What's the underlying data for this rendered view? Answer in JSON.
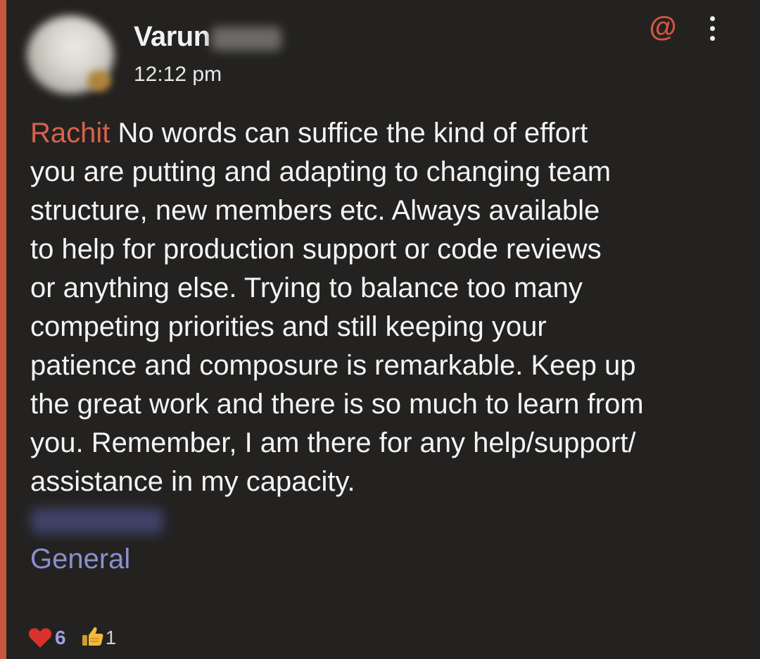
{
  "message": {
    "sender_name": "Varun",
    "timestamp": "12:12 pm",
    "mention_name": "Rachit",
    "body_lines": [
      " No words can suffice the kind of effort",
      "you are putting and adapting to changing team",
      "structure, new members etc. Always available",
      "to help for production support or code reviews",
      "or anything else. Trying to balance too many",
      "competing priorities and still keeping your",
      "patience and composure is remarkable. Keep up",
      "the great work and there is so much to learn from",
      "you. Remember, I am there for any help/support/",
      "assistance in my capacity."
    ],
    "channel": "General"
  },
  "header": {
    "mention_icon": "@"
  },
  "reactions": [
    {
      "icon": "heart-icon",
      "count": "6"
    },
    {
      "icon": "thumbs-up-icon",
      "count": "1"
    }
  ],
  "colors": {
    "background": "#232221",
    "mention_accent": "#c8553e",
    "link": "#8c8fcf",
    "reaction_count": "#9ea1e0"
  }
}
